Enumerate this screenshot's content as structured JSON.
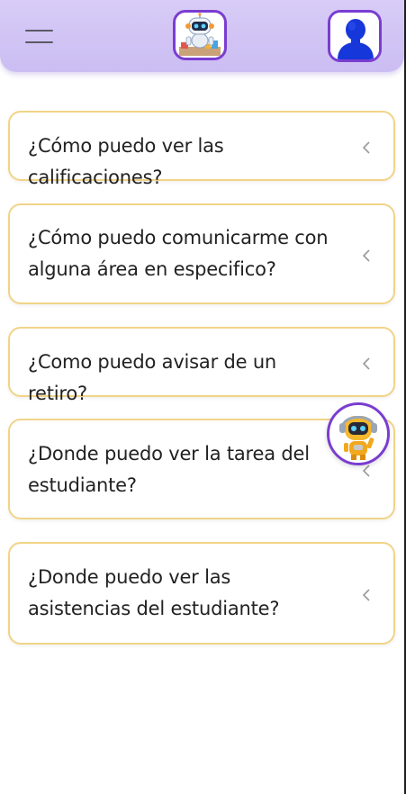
{
  "header": {
    "menu_icon": "hamburger-menu-icon",
    "logo_icon": "robot-mascot-logo-icon",
    "profile_icon": "user-avatar-icon"
  },
  "faqs": [
    {
      "question": "¿Cómo puedo ver las calificaciones?"
    },
    {
      "question": "¿Cómo puedo comunicarme con alguna área en especifico?"
    },
    {
      "question": "¿Como puedo avisar de un retiro?"
    },
    {
      "question": "¿Donde puedo ver la tarea del estudiante?"
    },
    {
      "question": "¿Donde puedo ver las asistencias del estudiante?"
    }
  ],
  "assistant": {
    "icon": "robot-assistant-icon"
  },
  "colors": {
    "header_bg": "#d8ccf7",
    "accent_purple": "#7a3dd1",
    "card_border": "#f1d488",
    "text": "#222222"
  }
}
